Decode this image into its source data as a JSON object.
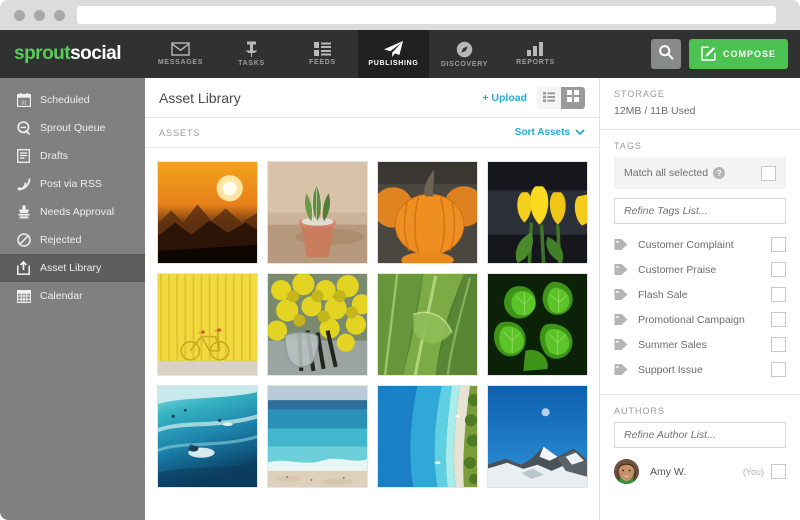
{
  "browser": {
    "url_value": "",
    "url_placeholder": ""
  },
  "topnav": {
    "brand_first": "sprout",
    "brand_second": "social",
    "tabs": [
      {
        "label": "MESSAGES",
        "icon": "envelope-icon",
        "active": false
      },
      {
        "label": "TASKS",
        "icon": "pin-icon",
        "active": false
      },
      {
        "label": "FEEDS",
        "icon": "list-icon",
        "active": false
      },
      {
        "label": "PUBLISHING",
        "icon": "paper-plane-icon",
        "active": true
      },
      {
        "label": "DISCOVERY",
        "icon": "compass-icon",
        "active": false
      },
      {
        "label": "REPORTS",
        "icon": "bar-chart-icon",
        "active": false
      }
    ],
    "search_icon": "search-icon",
    "compose_label": "COMPOSE",
    "compose_icon": "compose-pencil-icon",
    "colors": {
      "bar_bg": "#2f3230",
      "active_tab_bg": "#1f2120",
      "brand_green": "#59cb59",
      "compose_green": "#4cc253"
    }
  },
  "sidebar": {
    "items": [
      {
        "label": "Scheduled",
        "icon": "calendar-icon",
        "active": false
      },
      {
        "label": "Sprout Queue",
        "icon": "queue-search-icon",
        "active": false
      },
      {
        "label": "Drafts",
        "icon": "document-icon",
        "active": false
      },
      {
        "label": "Post via RSS",
        "icon": "rss-icon",
        "active": false
      },
      {
        "label": "Needs Approval",
        "icon": "stamp-icon",
        "active": false
      },
      {
        "label": "Rejected",
        "icon": "block-icon",
        "active": false
      },
      {
        "label": "Asset Library",
        "icon": "upload-box-icon",
        "active": true
      },
      {
        "label": "Calendar",
        "icon": "calendar-grid-icon",
        "active": false
      }
    ],
    "bg_color": "#808080",
    "active_bg_color": "#5e5e5e"
  },
  "main": {
    "title": "Asset Library",
    "upload_label": "+ Upload",
    "view_list_icon": "list-view-icon",
    "view_grid_icon": "grid-view-icon",
    "active_view": "grid",
    "assets_label": "ASSETS",
    "sort_label": "Sort Assets",
    "sort_chevron_icon": "chevron-down-icon",
    "link_color": "#27a9d6",
    "assets": [
      {
        "name": "sunset-mountains",
        "alt": "Orange sunset over mountain ridges"
      },
      {
        "name": "potted-cactus",
        "alt": "Small cactus in a terracotta pot"
      },
      {
        "name": "pumpkins",
        "alt": "Pile of orange pumpkins"
      },
      {
        "name": "yellow-tulips",
        "alt": "Yellow tulips on dark background"
      },
      {
        "name": "yellow-wall-bicycle",
        "alt": "Bicycle against a yellow corrugated wall"
      },
      {
        "name": "yellow-flowers",
        "alt": "Yellow chrysanthemums in a metal bucket"
      },
      {
        "name": "green-chard-leaves",
        "alt": "Close-up of green chard leaves"
      },
      {
        "name": "green-foliage",
        "alt": "Bright green leafy foliage"
      },
      {
        "name": "surfer-ocean",
        "alt": "Surfer riding a turquoise wave"
      },
      {
        "name": "beach-shoreline",
        "alt": "Turquoise sea meeting a sandy beach"
      },
      {
        "name": "aerial-coastline",
        "alt": "Aerial view of blue water along a green coast"
      },
      {
        "name": "snowy-peak",
        "alt": "Snow-capped peak against deep blue sky"
      }
    ]
  },
  "right": {
    "storage": {
      "title": "STORAGE",
      "value": "12MB / 11B Used"
    },
    "tags": {
      "title": "TAGS",
      "match_all_label": "Match all selected",
      "help_icon": "question-mark-icon",
      "match_all_checked": false,
      "refine_placeholder": "Refine Tags List...",
      "refine_value": "",
      "items": [
        {
          "label": "Customer Complaint",
          "icon": "tag-icon",
          "checked": false
        },
        {
          "label": "Customer Praise",
          "icon": "tag-icon",
          "checked": false
        },
        {
          "label": "Flash Sale",
          "icon": "tag-icon",
          "checked": false
        },
        {
          "label": "Promotional Campaign",
          "icon": "tag-icon",
          "checked": false
        },
        {
          "label": "Summer Sales",
          "icon": "tag-icon",
          "checked": false
        },
        {
          "label": "Support Issue",
          "icon": "tag-icon",
          "checked": false
        }
      ]
    },
    "authors": {
      "title": "AUTHORS",
      "refine_placeholder": "Refine Author List...",
      "refine_value": "",
      "items": [
        {
          "name": "Amy W.",
          "badge": "(You)",
          "avatar": "user-avatar",
          "checked": false
        }
      ]
    }
  }
}
